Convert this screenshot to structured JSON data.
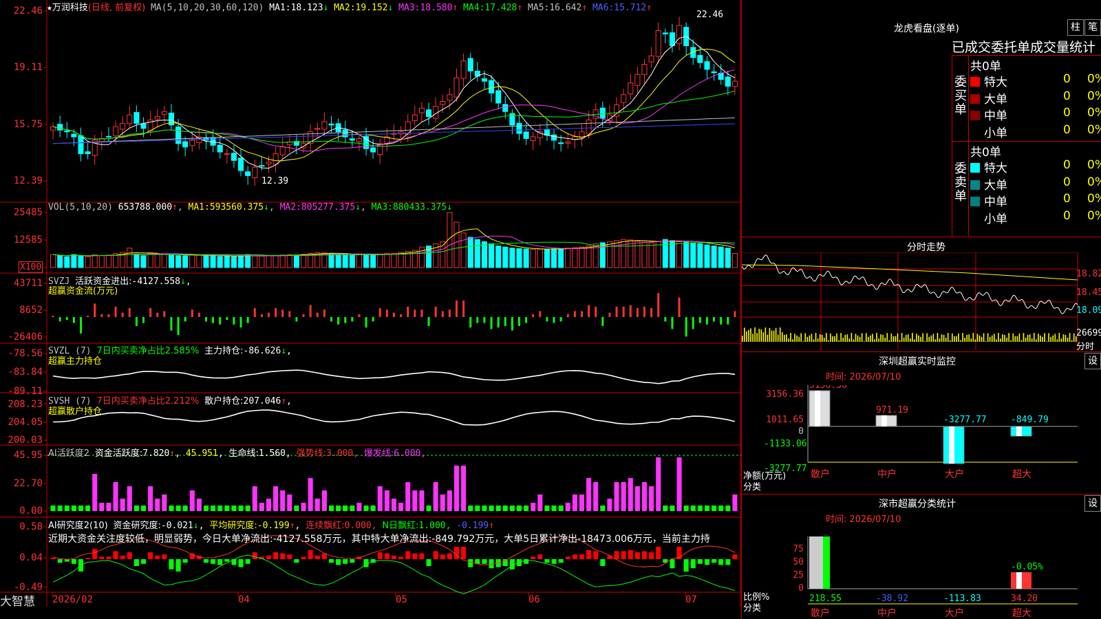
{
  "colors": {
    "up": "#ff3333",
    "down": "#00ffff",
    "grid": "#cc0000",
    "ma1": "#ffffff",
    "ma2": "#ffff00",
    "ma3": "#ff33ff",
    "ma4": "#00ff00",
    "ma5": "#c0c0c0",
    "ma6": "#3344ff"
  },
  "main": {
    "star": "★",
    "name": "万润科技",
    "mode": "(日线, 前复权)",
    "ma_def": "MA(5,10,20,30,60,120)",
    "ma_values": [
      {
        "label": "MA1:",
        "value": "18.123",
        "arrow": "↓"
      },
      {
        "label": "MA2:",
        "value": "19.152",
        "arrow": "↓"
      },
      {
        "label": "MA3:",
        "value": "18.580",
        "arrow": "↑"
      },
      {
        "label": "MA4:",
        "value": "17.428",
        "arrow": "↑"
      },
      {
        "label": "MA5:",
        "value": "16.642",
        "arrow": "↑"
      },
      {
        "label": "MA6:",
        "value": "15.712",
        "arrow": "↑"
      }
    ],
    "y_ticks": [
      "22.46",
      "19.11",
      "15.75",
      "12.39"
    ],
    "high_label": "22.46",
    "low_label": "12.39"
  },
  "vol": {
    "title": "VOL(5,10,20)",
    "value": "653788.000",
    "arrow": "↑",
    "ma": [
      {
        "label": "MA1:",
        "value": "593560.375",
        "arrow": "↓"
      },
      {
        "label": "MA2:",
        "value": "805277.375",
        "arrow": "↓"
      },
      {
        "label": "MA3:",
        "value": "880433.375",
        "arrow": "↓"
      }
    ],
    "y_ticks": [
      "25485",
      "12585",
      "X100"
    ]
  },
  "svzj": {
    "title": "SVZJ",
    "label": "活跃资金进出:",
    "value": "-4127.558",
    "arrow": "↓",
    "suffix": ",",
    "sub": "超赢资金流(万元)",
    "y_ticks": [
      "43711",
      "8652",
      "-26406"
    ]
  },
  "svzl": {
    "title": "SVZL (7)",
    "label1": "7日内买卖净占比2.585%",
    "label2": "主力持仓:",
    "value": "-86.626",
    "arrow": "↓",
    "suffix": ",",
    "sub": "超赢主力持仓",
    "y_ticks": [
      "-78.56",
      "-83.84",
      "-89.11"
    ]
  },
  "svsh": {
    "title": "SVSH (7)",
    "label1": "7日内买卖净占比2.212%",
    "label2": "散户持仓:",
    "value": "207.046",
    "arrow": "↑",
    "suffix": ",",
    "sub": "超赢散户持仓",
    "y_ticks": [
      "208.23",
      "204.05",
      "200.03"
    ]
  },
  "ai1": {
    "title": "AI活跃度2",
    "label": "资金活跃度:",
    "value": "7.820",
    "arrow": "↑",
    "v2": "45.951",
    "l3": "生命线:",
    "v3": "1.560",
    "l4": "强势线:",
    "v4": "3.000",
    "l5": "爆发线:",
    "v5": "6.000",
    "y_ticks": [
      "45.95",
      "22.70",
      "0.00"
    ]
  },
  "ai2": {
    "title": "AI研究度2(10)",
    "label": "资金研究度:",
    "value": "-0.021",
    "arrow": "↓",
    "l2": "平均研究度:",
    "v2": "-0.199",
    "a2": "↑",
    "l3": "连续飘红:",
    "v3": "0.000",
    "l4": "N日飘红:",
    "v4": "1.000",
    "v5": "-0.199",
    "a5": "↑",
    "text": "近期大资金关注度较低，明显弱势，今日大单净流出:-4127.558万元，其中特大单净流出:-849.792万元，大单5日累计净出-18473.006万元，当前主力持",
    "y_ticks": [
      "0.58",
      "0.04",
      "-0.49"
    ]
  },
  "xaxis": {
    "brand": "大智慧",
    "labels": [
      "2026/02",
      "04",
      "05",
      "06",
      "07"
    ]
  },
  "right": {
    "lhb_title": "龙虎看盘(逐单)",
    "btn1": "柱",
    "btn2": "笔",
    "tabs": [
      "已成交",
      "委托单",
      "成交量统计"
    ],
    "buy_side": "委买单",
    "sell_side": "委卖单",
    "buy_total": "共0单",
    "sell_total": "共0单",
    "rows": [
      {
        "name": "特大",
        "num": "0",
        "pct": "0%"
      },
      {
        "name": "大单",
        "num": "0",
        "pct": "0%"
      },
      {
        "name": "中单",
        "num": "0",
        "pct": "0%"
      },
      {
        "name": "小单",
        "num": "0",
        "pct": "0%"
      }
    ],
    "fs_title": "分时走势",
    "fs_ticks": [
      "18.82",
      "18.45",
      "18.09",
      "26699"
    ],
    "fs_unit": "分时",
    "m1_title": "深圳超赢实时监控",
    "m1_btn": "设",
    "m1_time": "时间: 2026/07/10",
    "m1_ticks": [
      "3156.36",
      "1011.65",
      "0",
      "-1133.06",
      "-3277.77"
    ],
    "m1_ylabel": "净额(万元)",
    "m1_xlabel": "分类",
    "m1_bars": [
      {
        "cat": "散户",
        "value": 3156.36,
        "label": "3156.36"
      },
      {
        "cat": "中户",
        "value": 971.19,
        "label": "971.19"
      },
      {
        "cat": "大户",
        "value": -3277.77,
        "label": "-3277.77"
      },
      {
        "cat": "超大",
        "value": -849.79,
        "label": "-849.79"
      }
    ],
    "m2_title": "深市超赢分类统计",
    "m2_btn": "设",
    "m2_time": "时间: 2026/07/10",
    "m2_ticks": [
      "75",
      "50",
      "25",
      "0"
    ],
    "m2_ylabel": "比例%",
    "m2_xlabel": "分类",
    "m2_top_label": "-0.05%",
    "m2_values": [
      {
        "cat": "散户",
        "label": "218.55"
      },
      {
        "cat": "中户",
        "label": "-38.92"
      },
      {
        "cat": "大户",
        "label": "-113.83"
      },
      {
        "cat": "超大",
        "label": "34.20"
      }
    ]
  },
  "chart_data": [
    {
      "type": "candlestick",
      "title": "万润科技 (日线, 前复权)",
      "ylim": [
        12.39,
        22.46
      ],
      "ma_series": [
        "MA1",
        "MA2",
        "MA3",
        "MA4",
        "MA5",
        "MA6"
      ],
      "close": [
        15.6,
        15.4,
        15.3,
        15.0,
        14.0,
        14.0,
        14.8,
        14.9,
        15.0,
        15.6,
        15.8,
        16.3,
        15.8,
        15.5,
        16.0,
        16.2,
        16.5,
        15.7,
        14.6,
        14.4,
        14.8,
        15.0,
        14.8,
        14.5,
        14.1,
        14.0,
        13.6,
        13.0,
        12.7,
        13.2,
        13.3,
        13.5,
        14.0,
        14.4,
        14.7,
        14.5,
        14.6,
        15.3,
        15.5,
        15.9,
        15.7,
        15.3,
        15.0,
        14.8,
        14.9,
        14.3,
        14.1,
        14.6,
        15.0,
        15.2,
        15.3,
        15.9,
        16.3,
        16.7,
        16.2,
        16.8,
        17.1,
        17.5,
        18.5,
        19.5,
        18.9,
        18.6,
        18.3,
        17.6,
        17.0,
        16.5,
        15.7,
        15.2,
        14.9,
        15.0,
        15.3,
        15.1,
        14.8,
        14.6,
        14.7,
        15.0,
        15.3,
        16.0,
        16.6,
        16.1,
        16.3,
        16.9,
        17.5,
        18.2,
        18.7,
        19.3,
        19.8,
        21.3,
        21.1,
        20.4,
        21.6,
        20.4,
        19.7,
        19.4,
        19.0,
        18.8,
        18.4,
        18.0,
        18.3
      ],
      "volume_x100": [
        6000,
        5500,
        5000,
        6000,
        5500,
        5000,
        6000,
        5500,
        5800,
        6500,
        7000,
        9000,
        6000,
        5500,
        6500,
        6000,
        6200,
        5900,
        5500,
        5400,
        6000,
        5800,
        5600,
        5400,
        5200,
        5300,
        5000,
        5500,
        6000,
        5400,
        5300,
        5500,
        5600,
        5800,
        6000,
        5800,
        6200,
        6500,
        7000,
        6800,
        6600,
        6200,
        6000,
        5900,
        6000,
        5800,
        6000,
        6200,
        6500,
        6600,
        7000,
        7500,
        8000,
        9500,
        10000,
        11000,
        12000,
        25485,
        21000,
        16000,
        14000,
        13000,
        12000,
        11000,
        10000,
        9500,
        9000,
        8800,
        8600,
        8400,
        8500,
        8600,
        8700,
        8800,
        9000,
        9200,
        9500,
        10000,
        11000,
        11500,
        12000,
        12500,
        13000,
        12800,
        12200,
        11800,
        11500,
        12000,
        13000,
        12500,
        12000,
        11800,
        11500,
        11000,
        10500,
        10000,
        9500,
        9000,
        6537
      ]
    }
  ]
}
